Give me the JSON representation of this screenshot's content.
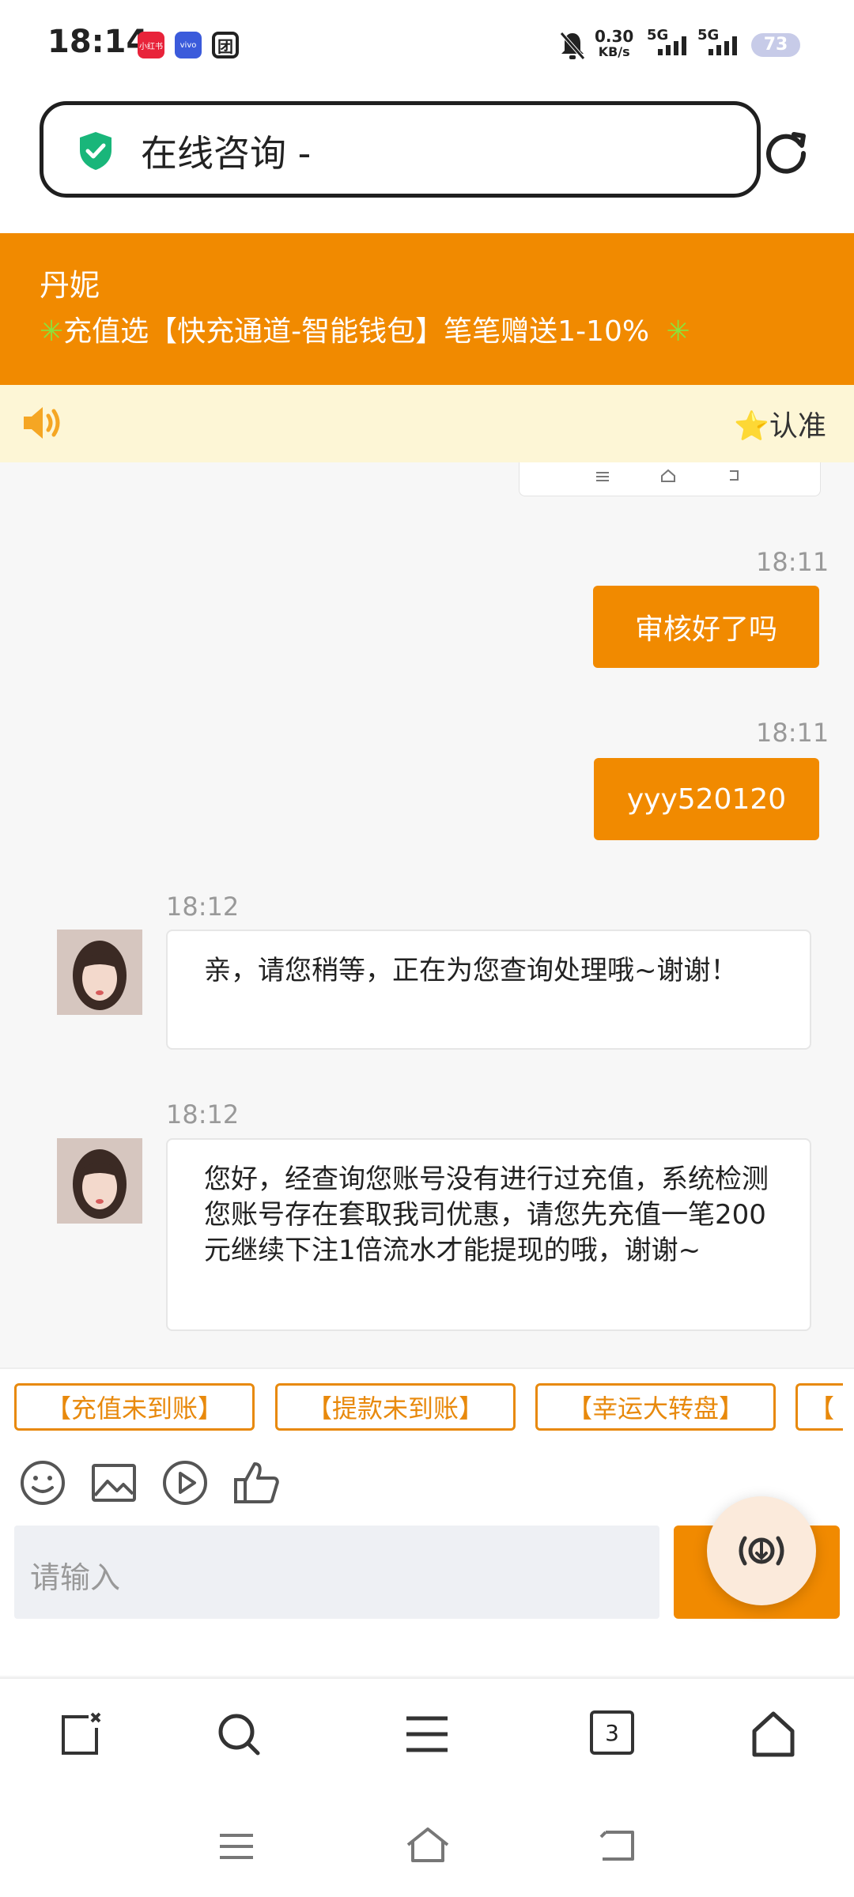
{
  "status_bar": {
    "time": "18:14",
    "apps": [
      "小红书",
      "vivo",
      "团"
    ],
    "net_speed_value": "0.30",
    "net_speed_unit": "KB/s",
    "sim1": "5G",
    "sim2": "5G",
    "battery": "73"
  },
  "address_bar": {
    "title": "在线咨询 -",
    "secure_icon": "shield-check-icon",
    "reload_icon": "reload-icon"
  },
  "banner": {
    "agent_name": "丹妮",
    "promo_text": "充值选【快充通道-智能钱包】笔笔赠送1-10%",
    "promo_star": "✳"
  },
  "notice": {
    "text": "⭐认准"
  },
  "messages": [
    {
      "time": "18:11",
      "text": "审核好了吗",
      "from": "user"
    },
    {
      "time": "18:11",
      "text": "yyy520120",
      "from": "user"
    },
    {
      "time": "18:12",
      "text": "亲，请您稍等，正在为您查询处理哦~谢谢！",
      "from": "agent"
    },
    {
      "time": "18:12",
      "text": "您好，经查询您账号没有进行过充值，系统检测您账号存在套取我司优惠，请您先充值一笔200元继续下注1倍流水才能提现的哦，谢谢~",
      "from": "agent"
    }
  ],
  "quick_links": [
    "【充值未到账】",
    "【提款未到账】",
    "【幸运大转盘】",
    "【"
  ],
  "toolbar_icons": [
    "emoji-icon",
    "image-icon",
    "video-icon",
    "thumbs-up-icon"
  ],
  "input": {
    "placeholder": "请输入"
  },
  "browser_nav": {
    "tab_count": "3"
  },
  "colors": {
    "accent": "#f18a00",
    "notice_bg": "#fdf6d6",
    "star_green": "#8be33a"
  }
}
